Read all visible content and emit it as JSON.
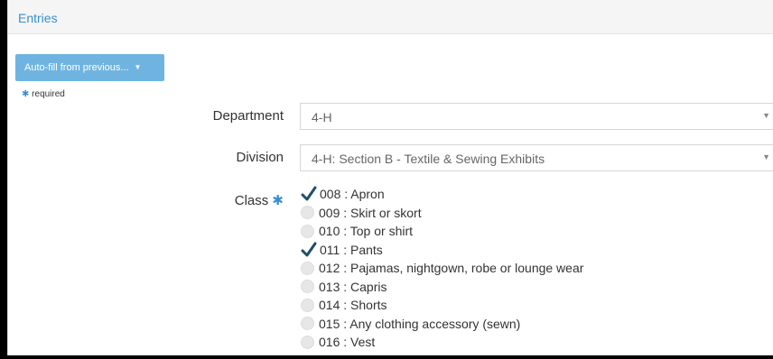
{
  "header": {
    "title": "Entries"
  },
  "autofill": {
    "label": "Auto-fill from previous...",
    "caret": "▼"
  },
  "required_note": {
    "star": "✱",
    "text": "required"
  },
  "department": {
    "label": "Department",
    "value": "4-H",
    "arrow": "▼"
  },
  "division": {
    "label": "Division",
    "value": "4-H: Section B - Textile & Sewing Exhibits",
    "arrow": "▼"
  },
  "class": {
    "label": "Class",
    "star": "✱",
    "options": [
      {
        "text": "008 : Apron",
        "checked": true
      },
      {
        "text": "009 : Skirt or skort",
        "checked": false
      },
      {
        "text": "010 : Top or shirt",
        "checked": false
      },
      {
        "text": "011 : Pants",
        "checked": true
      },
      {
        "text": "012 : Pajamas, nightgown, robe or lounge wear",
        "checked": false
      },
      {
        "text": "013 : Capris",
        "checked": false
      },
      {
        "text": "014 : Shorts",
        "checked": false
      },
      {
        "text": "015 : Any clothing accessory (sewn)",
        "checked": false
      },
      {
        "text": "016 : Vest",
        "checked": false
      }
    ]
  },
  "colors": {
    "accent": "#3a8fcf",
    "button": "#6fb4e1",
    "check": "#1f4f66"
  }
}
